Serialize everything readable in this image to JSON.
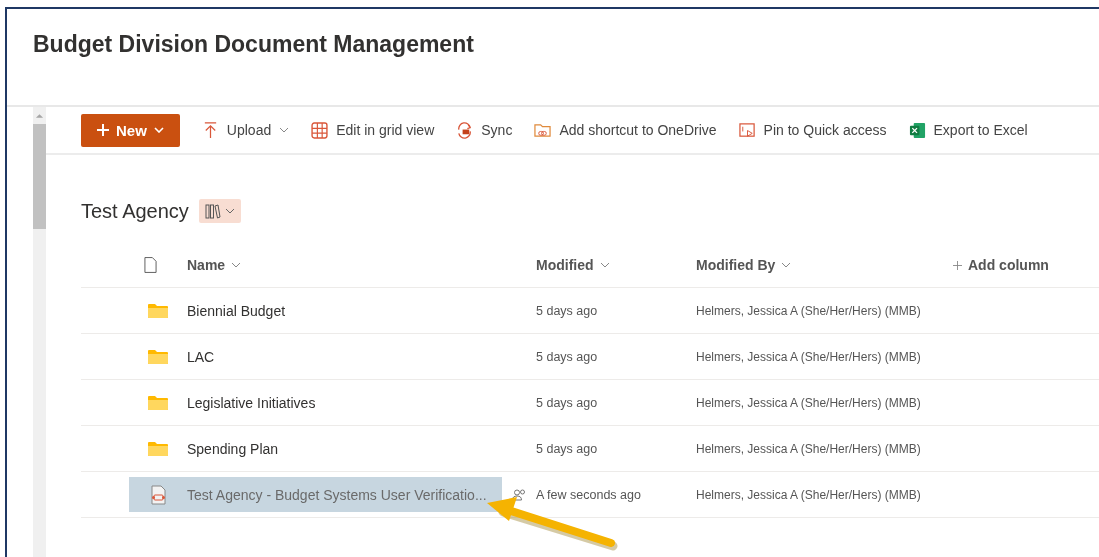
{
  "title": "Budget Division Document Management",
  "toolbar": [
    {
      "kind": "primary",
      "label": "New"
    },
    {
      "kind": "dropdown",
      "label": "Upload"
    },
    {
      "kind": "command",
      "label": "Edit in grid view"
    },
    {
      "kind": "command",
      "label": "Sync"
    },
    {
      "kind": "command",
      "label": "Add shortcut to OneDrive"
    },
    {
      "kind": "command",
      "label": "Pin to Quick access"
    },
    {
      "kind": "command",
      "label": "Export to Excel"
    }
  ],
  "library": {
    "title": "Test Agency"
  },
  "table": {
    "columns": [
      {
        "label": "Name",
        "kind": "sort"
      },
      {
        "label": "Modified",
        "kind": "sort"
      },
      {
        "label": "Modified By",
        "kind": "sort"
      },
      {
        "label": "Add column",
        "kind": "add"
      }
    ],
    "rows": [
      {
        "kind": "folder",
        "name": "Biennial Budget",
        "modified": "5 days ago",
        "modified_by": "Helmers, Jessica A (She/Her/Hers) (MMB)",
        "selected": false,
        "shared": false
      },
      {
        "kind": "folder",
        "name": "LAC",
        "modified": "5 days ago",
        "modified_by": "Helmers, Jessica A (She/Her/Hers) (MMB)",
        "selected": false,
        "shared": false
      },
      {
        "kind": "folder",
        "name": "Legislative Initiatives",
        "modified": "5 days ago",
        "modified_by": "Helmers, Jessica A (She/Her/Hers) (MMB)",
        "selected": false,
        "shared": false
      },
      {
        "kind": "folder",
        "name": "Spending Plan",
        "modified": "5 days ago",
        "modified_by": "Helmers, Jessica A (She/Her/Hers) (MMB)",
        "selected": false,
        "shared": false
      },
      {
        "kind": "file",
        "name": "Test Agency - Budget Systems User Verificatio...",
        "modified": "A few seconds ago",
        "modified_by": "Helmers, Jessica A (She/Her/Hers) (MMB)",
        "selected": true,
        "shared": true
      }
    ]
  }
}
